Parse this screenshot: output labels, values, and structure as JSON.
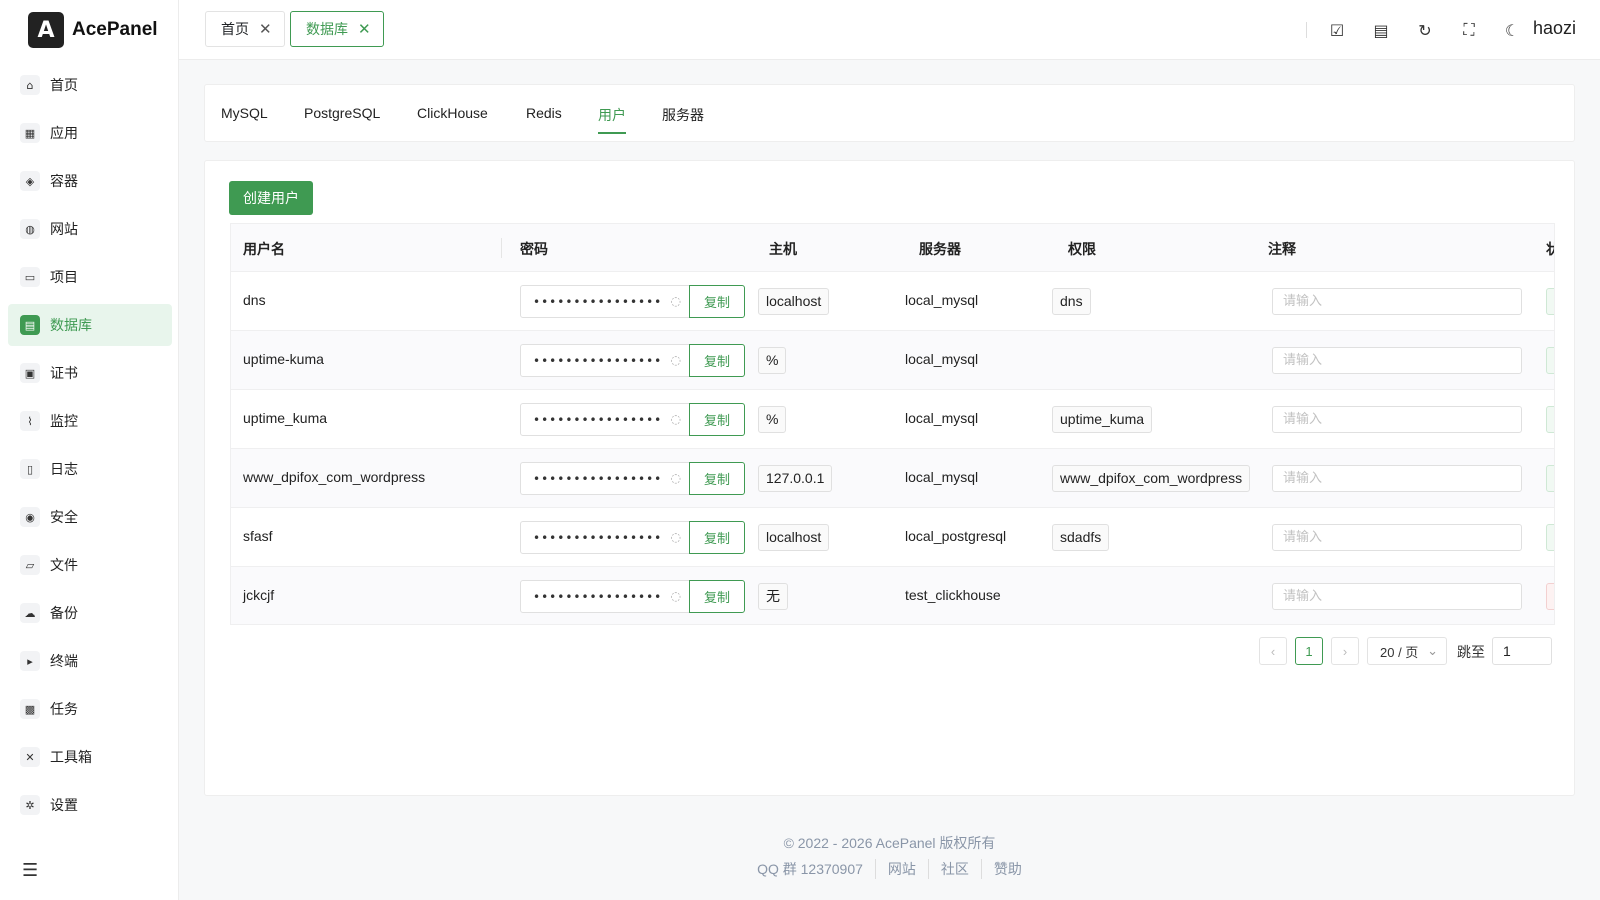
{
  "brand": {
    "logo_text": "A",
    "name": "AcePanel"
  },
  "sidebar": {
    "items": [
      {
        "label": "首页",
        "icon": "⌂",
        "name": "home"
      },
      {
        "label": "应用",
        "icon": "▦",
        "name": "apps"
      },
      {
        "label": "容器",
        "icon": "◈",
        "name": "container"
      },
      {
        "label": "网站",
        "icon": "◍",
        "name": "website"
      },
      {
        "label": "项目",
        "icon": "▭",
        "name": "project"
      },
      {
        "label": "数据库",
        "icon": "▤",
        "name": "database"
      },
      {
        "label": "证书",
        "icon": "▣",
        "name": "certificate"
      },
      {
        "label": "监控",
        "icon": "⌇",
        "name": "monitor"
      },
      {
        "label": "日志",
        "icon": "▯",
        "name": "log"
      },
      {
        "label": "安全",
        "icon": "◉",
        "name": "security"
      },
      {
        "label": "文件",
        "icon": "▱",
        "name": "files"
      },
      {
        "label": "备份",
        "icon": "☁",
        "name": "backup"
      },
      {
        "label": "终端",
        "icon": "▸",
        "name": "terminal"
      },
      {
        "label": "任务",
        "icon": "▩",
        "name": "tasks"
      },
      {
        "label": "工具箱",
        "icon": "✕",
        "name": "toolbox"
      },
      {
        "label": "设置",
        "icon": "✲",
        "name": "settings"
      }
    ],
    "active_index": 5,
    "collapse_icon": "☰"
  },
  "header": {
    "tabs": [
      {
        "label": "首页",
        "close": "✕"
      },
      {
        "label": "数据库",
        "close": "✕"
      }
    ],
    "icons": [
      "☑",
      "▤",
      "↻",
      "⛶",
      "☾"
    ],
    "username": "haozi"
  },
  "type_tabs": [
    "MySQL",
    "PostgreSQL",
    "ClickHouse",
    "Redis",
    "用户",
    "服务器"
  ],
  "active_type_tab": 4,
  "toolbar": {
    "create_label": "创建用户"
  },
  "table": {
    "columns": [
      "用户名",
      "密码",
      "主机",
      "服务器",
      "权限",
      "注释",
      "状"
    ],
    "copy_label": "复制",
    "eye_icon": "◌",
    "note_placeholder": "请输入",
    "rows": [
      {
        "username": "dns",
        "password": "••••••••••••••••",
        "host": "localhost",
        "server": "local_mysql",
        "privilege": "dns"
      },
      {
        "username": "uptime-kuma",
        "password": "••••••••••••••••",
        "host": "%",
        "server": "local_mysql",
        "privilege": ""
      },
      {
        "username": "uptime_kuma",
        "password": "••••••••••••••••",
        "host": "%",
        "server": "local_mysql",
        "privilege": "uptime_kuma"
      },
      {
        "username": "www_dpifox_com_wordpress",
        "password": "••••••••••••••••••••",
        "host": "127.0.0.1",
        "server": "local_mysql",
        "privilege": "www_dpifox_com_wordpress"
      },
      {
        "username": "sfasf",
        "password": "••••••••••••••••",
        "host": "localhost",
        "server": "local_postgresql",
        "privilege": "sdadfs"
      },
      {
        "username": "jckcjf",
        "password": "••••••••••••••••",
        "host": "无",
        "server": "test_clickhouse",
        "privilege": ""
      }
    ]
  },
  "pagination": {
    "prev": "‹",
    "page": "1",
    "next": "›",
    "page_size": "20 / 页",
    "dropdown_icon": "⌄",
    "jump_label": "跳至",
    "jump_value": "1"
  },
  "footer": {
    "copyright": "© 2022 - 2026 AcePanel 版权所有",
    "qq": "QQ 群 12370907",
    "links": [
      "网站",
      "社区",
      "赞助"
    ]
  },
  "colors": {
    "accent": "#3f9a52",
    "accent_bg": "#e8f5ec"
  }
}
